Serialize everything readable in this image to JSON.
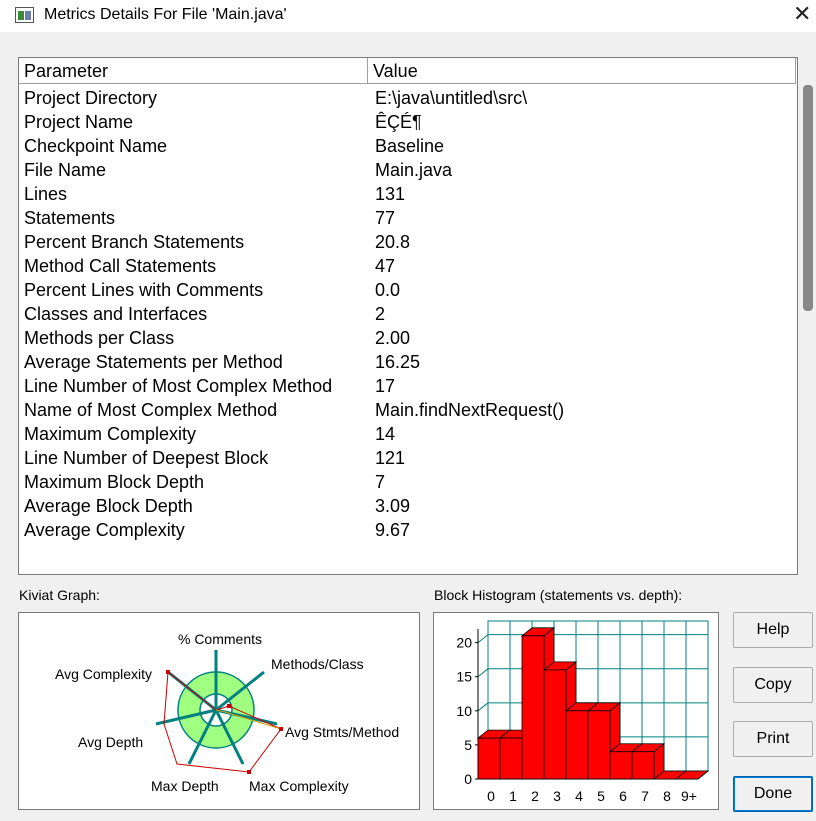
{
  "window": {
    "title": "Metrics Details For File 'Main.java'"
  },
  "table": {
    "headers": {
      "parameter": "Parameter",
      "value": "Value"
    },
    "rows": [
      {
        "parameter": "Project Directory",
        "value": "E:\\java\\untitled\\src\\"
      },
      {
        "parameter": "Project Name",
        "value": "ÊÇÉ¶"
      },
      {
        "parameter": "Checkpoint Name",
        "value": "Baseline"
      },
      {
        "parameter": "File Name",
        "value": "Main.java"
      },
      {
        "parameter": "Lines",
        "value": "131"
      },
      {
        "parameter": "Statements",
        "value": "77"
      },
      {
        "parameter": "Percent Branch Statements",
        "value": "20.8"
      },
      {
        "parameter": "Method Call Statements",
        "value": "47"
      },
      {
        "parameter": "Percent Lines with Comments",
        "value": "0.0"
      },
      {
        "parameter": "Classes and Interfaces",
        "value": "2"
      },
      {
        "parameter": "Methods per Class",
        "value": "2.00"
      },
      {
        "parameter": "Average Statements per Method",
        "value": "16.25"
      },
      {
        "parameter": "Line Number of Most Complex Method",
        "value": "17"
      },
      {
        "parameter": "Name of Most Complex Method",
        "value": "Main.findNextRequest()"
      },
      {
        "parameter": "Maximum Complexity",
        "value": "14"
      },
      {
        "parameter": "Line Number of Deepest Block",
        "value": "121"
      },
      {
        "parameter": "Maximum Block Depth",
        "value": "7"
      },
      {
        "parameter": "Average Block Depth",
        "value": "3.09"
      },
      {
        "parameter": "Average Complexity",
        "value": "9.67"
      }
    ]
  },
  "kiviat": {
    "label": "Kiviat Graph:",
    "axes": {
      "comments": "% Comments",
      "methods": "Methods/Class",
      "stmts": "Avg Stmts/Method",
      "maxcomplexity": "Max Complexity",
      "maxdepth": "Max Depth",
      "avgdepth": "Avg Depth",
      "avgcomplexity": "Avg Complexity"
    }
  },
  "histogram": {
    "label": "Block Histogram (statements vs. depth):"
  },
  "buttons": {
    "help": "Help",
    "copy": "Copy",
    "print": "Print",
    "done": "Done"
  },
  "colors": {
    "bar": "#ff0000",
    "grid": "#008080",
    "ring": "#a0ff80",
    "polygon": "#cc0000"
  },
  "chart_data": {
    "type": "bar",
    "categories": [
      "0",
      "1",
      "2",
      "3",
      "4",
      "5",
      "6",
      "7",
      "8",
      "9+"
    ],
    "values": [
      6,
      6,
      21,
      16,
      10,
      10,
      4,
      4,
      0,
      0
    ],
    "title": "",
    "xlabel": "",
    "ylabel": "",
    "ylim": [
      0,
      22
    ],
    "yticks": [
      "0",
      "5",
      "10",
      "15",
      "20"
    ],
    "grid": true
  }
}
